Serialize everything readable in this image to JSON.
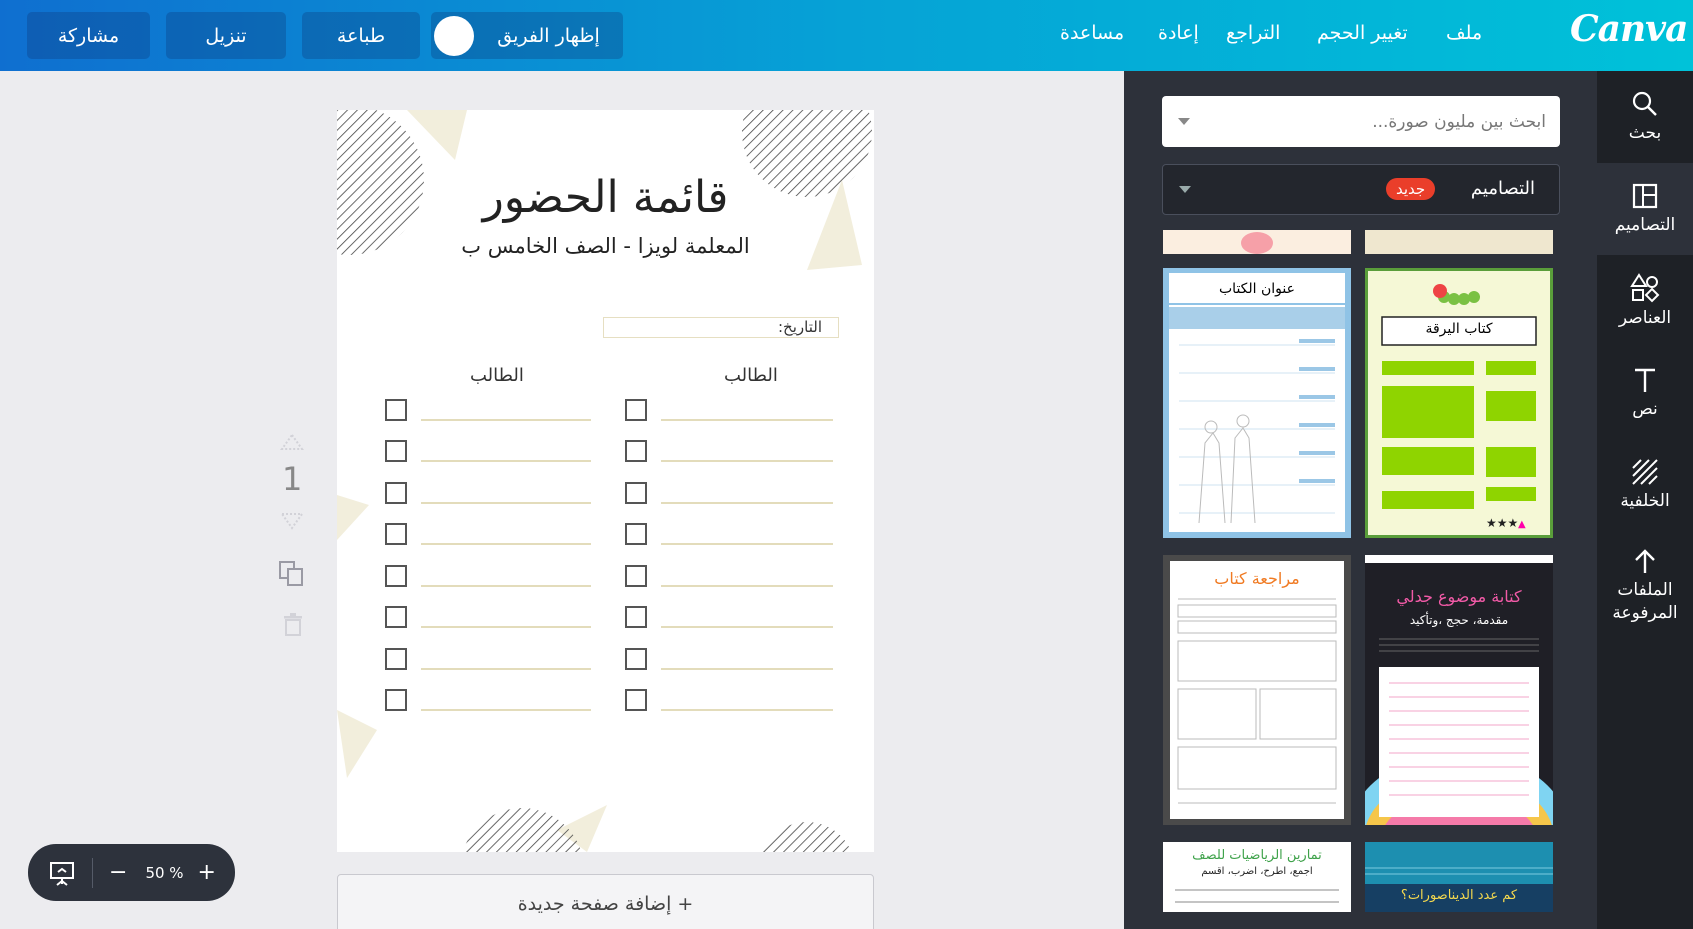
{
  "app": {
    "logo": "Canva"
  },
  "topbar": {
    "menu": [
      "ملف",
      "تغيير الحجم",
      "التراجع",
      "إعادة",
      "مساعدة"
    ],
    "show_team": "إظهار الفريق",
    "print": "طباعة",
    "download": "تنزيل",
    "share": "مشاركة"
  },
  "rail": {
    "items": [
      "بحث",
      "التصاميم",
      "العناصر",
      "نص",
      "الخلفية",
      "الملفات المرفوعة"
    ]
  },
  "panel": {
    "search_placeholder": "ابحث بين مليون صورة...",
    "designs_label": "التصاميم",
    "new_badge": "جديد",
    "templates": [
      {
        "title": "عنوان الكتاب"
      },
      {
        "title": "كتاب اليرقة"
      },
      {
        "title": "مراجعة كتاب"
      },
      {
        "title": "كتابة موضوع جدلي",
        "subtitle": "مقدمة، حجج ،وتأكيد"
      },
      {
        "title": "تمارين الرياضيات للصف",
        "subtitle": "اجمع، اطرح، اضرب، اقسم"
      },
      {
        "title": "كم عدد الديناصورات؟"
      }
    ]
  },
  "page": {
    "title": "قائمة الحضور",
    "subtitle": "المعلمة لويزا - الصف الخامس ب",
    "date_label": "التاريخ:",
    "col_right": "الطالب",
    "col_left": "الطالب",
    "number": "1"
  },
  "add_page": "+ إضافة صفحة جديدة",
  "zoom": {
    "level": "50 %"
  },
  "colors": {
    "accent": "#00c4cc",
    "badge": "#ea3e2a",
    "caterpillar_green": "#8fd400"
  }
}
